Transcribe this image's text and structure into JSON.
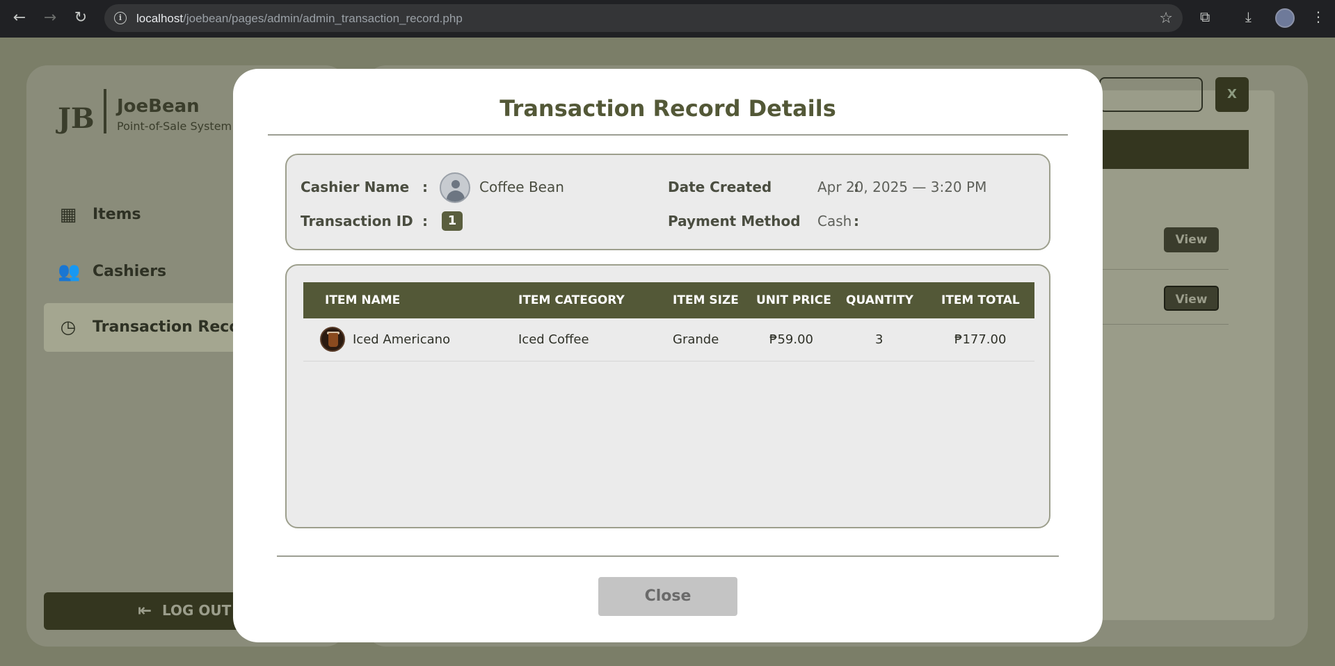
{
  "browser": {
    "url_host": "localhost",
    "url_path": "/joebean/pages/admin/admin_transaction_record.php"
  },
  "sidebar": {
    "brand_name": "JoeBean",
    "brand_subtitle": "Point-of-Sale System",
    "items": [
      {
        "label": "Items",
        "icon": "grid-icon"
      },
      {
        "label": "Cashiers",
        "icon": "users-icon"
      },
      {
        "label": "Transaction Reco",
        "icon": "clock-icon",
        "active": true
      }
    ],
    "logout_label": "LOG OUT"
  },
  "background": {
    "view_label_1": "View",
    "view_label_2": "View",
    "excel_icon": "X"
  },
  "modal": {
    "title": "Transaction Record Details",
    "cashier_name_label": "Cashier Name",
    "cashier_name_value": "Coffee Bean",
    "transaction_id_label": "Transaction ID",
    "transaction_id_value": "1",
    "date_created_label": "Date Created",
    "date_created_value": "Apr 20, 2025 — 3:20 PM",
    "payment_method_label": "Payment Method",
    "payment_method_value": "Cash",
    "colon": ":",
    "table": {
      "headers": [
        "ITEM NAME",
        "ITEM CATEGORY",
        "ITEM SIZE",
        "UNIT PRICE",
        "QUANTITY",
        "ITEM TOTAL"
      ],
      "rows": [
        {
          "name": "Iced Americano",
          "category": "Iced Coffee",
          "size": "Grande",
          "unit_price": "₱59.00",
          "quantity": "3",
          "total": "₱177.00"
        }
      ]
    },
    "close_label": "Close"
  },
  "colors": {
    "accent": "#535837",
    "overlay": "#7b7e68",
    "close_button": "#c4c4c4"
  }
}
